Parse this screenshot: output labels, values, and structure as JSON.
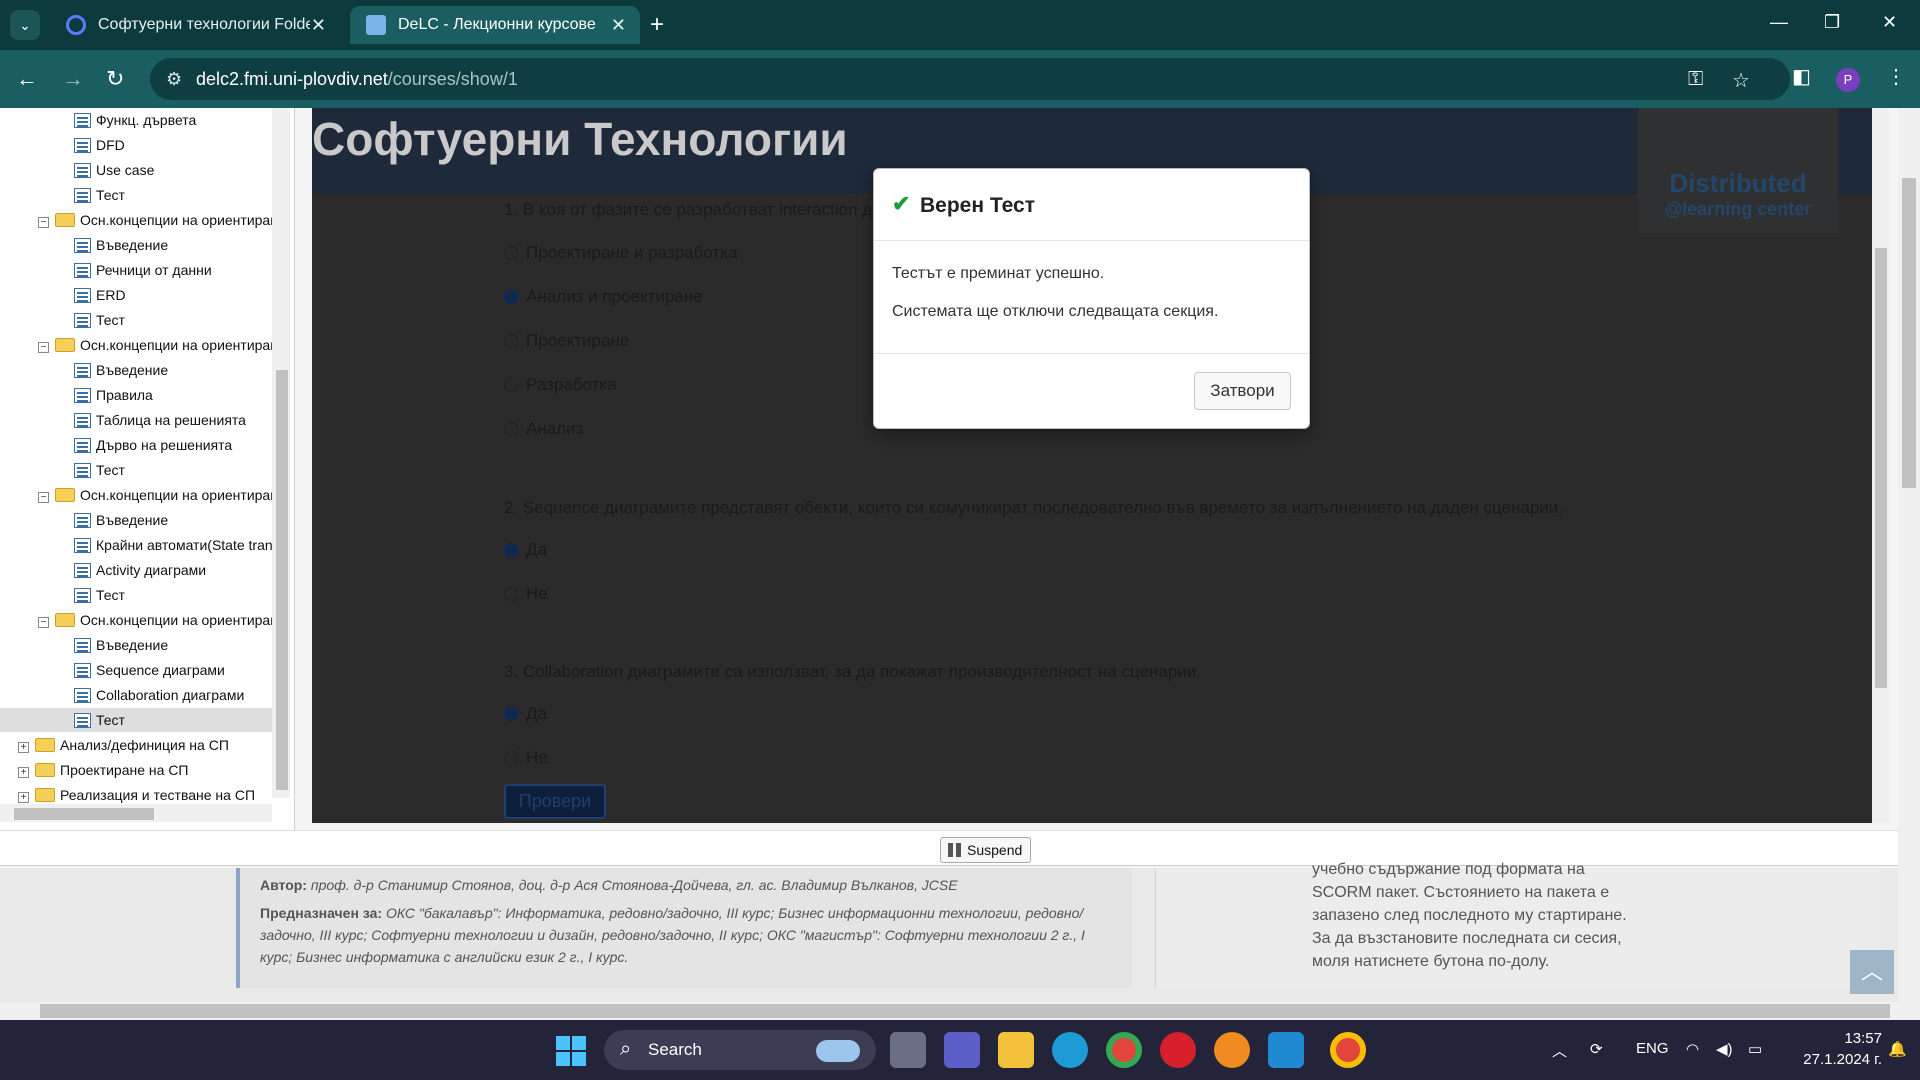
{
  "browser": {
    "tabs": [
      {
        "title": "Софтуерни технологии Folder",
        "close": "✕"
      },
      {
        "title": "DeLC - Лекционни курсове",
        "close": "✕"
      }
    ],
    "url_host": "delc2.fmi.uni-plovdiv.net",
    "url_path": "/courses/show/1",
    "profile_initial": "P"
  },
  "tree": {
    "nodes": [
      {
        "label": "Функц. дървета",
        "kind": "doc"
      },
      {
        "label": "DFD",
        "kind": "doc"
      },
      {
        "label": "Use case",
        "kind": "doc"
      },
      {
        "label": "Тест",
        "kind": "doc"
      },
      {
        "label": "Осн.концепции на ориентиран",
        "kind": "folder",
        "tog": "−"
      },
      {
        "label": "Въведение",
        "kind": "doc"
      },
      {
        "label": "Речници от данни",
        "kind": "doc"
      },
      {
        "label": "ERD",
        "kind": "doc"
      },
      {
        "label": "Тест",
        "kind": "doc"
      },
      {
        "label": "Осн.концепции на ориентиран",
        "kind": "folder",
        "tog": "−"
      },
      {
        "label": "Въведение",
        "kind": "doc"
      },
      {
        "label": "Правила",
        "kind": "doc"
      },
      {
        "label": "Таблица на решенията",
        "kind": "doc"
      },
      {
        "label": "Дърво на решенията",
        "kind": "doc"
      },
      {
        "label": "Тест",
        "kind": "doc"
      },
      {
        "label": "Осн.концепции на ориентиран",
        "kind": "folder",
        "tog": "−"
      },
      {
        "label": "Въведение",
        "kind": "doc"
      },
      {
        "label": "Крайни автомати(State tran",
        "kind": "doc"
      },
      {
        "label": "Activity диаграми",
        "kind": "doc"
      },
      {
        "label": "Тест",
        "kind": "doc"
      },
      {
        "label": "Осн.концепции на ориентиран",
        "kind": "folder",
        "tog": "−"
      },
      {
        "label": "Въведение",
        "kind": "doc"
      },
      {
        "label": "Sequence диаграми",
        "kind": "doc"
      },
      {
        "label": "Collaboration диаграми",
        "kind": "doc"
      },
      {
        "label": "Тест",
        "kind": "doc",
        "selected": true
      },
      {
        "label": "Анализ/дефиниция на СП",
        "kind": "folder",
        "tog": "+"
      },
      {
        "label": "Проектиране на СП",
        "kind": "folder",
        "tog": "+"
      },
      {
        "label": "Реализация и тестване на СП",
        "kind": "folder",
        "tog": "+"
      }
    ]
  },
  "course": {
    "title": "Софтуерни Технологии",
    "logo_line1": "Distributed",
    "logo_line2": "@learning center"
  },
  "quiz": {
    "q1": "1. В коя от фазите се разработват interaction ди",
    "q1_options": [
      "Проектиране и разработка",
      "Анализ и проектиране",
      "Проектиране",
      "Разработка",
      "Анализ"
    ],
    "q2": "2. Sequence диаграмите представят обекти, които си комуникират последователно във времето за изпълнението на даден сценарии.",
    "q2_options": [
      "Да",
      "Не"
    ],
    "q3": "3. Collaboration диаграмите са използват, за да покажат производителност на сценарии.",
    "q3_options": [
      "Да",
      "Не"
    ],
    "check_label": "Провери"
  },
  "suspend_label": "Suspend",
  "info": {
    "author_label": "Автор:",
    "author_value": "проф. д-р Станимир Стоянов, доц. д-р Ася Стоянова-Дойчева, гл. ас. Владимир Вълканов, JCSE",
    "for_label": "Предназначен за:",
    "for_value": "ОКС \"бакалавър\": Информатика, редовно/задочно, III курс; Бизнес информационни технологии, редовно/задочно, III курс; Софтуерни технологии и дизайн, редовно/задочно, II курс; ОКС \"магистър\": Софтуерни технологии 2 г., I курс; Бизнес информатика с английски език 2 г., I курс.",
    "right_text": "учебно съдържание под формата на SCORM пакет. Състоянието на пакета е запазено след последното му стартиране. За да възстановите последната си сесия, моля натиснете бутона по-долу."
  },
  "modal": {
    "title": "Верен Тест",
    "line1": "Тестът е преминат успешно.",
    "line2": "Системата ще отключи следващата секция.",
    "close_label": "Затвори"
  },
  "taskbar": {
    "search_label": "Search",
    "lang": "ENG",
    "time": "13:57",
    "date": "27.1.2024 г."
  }
}
